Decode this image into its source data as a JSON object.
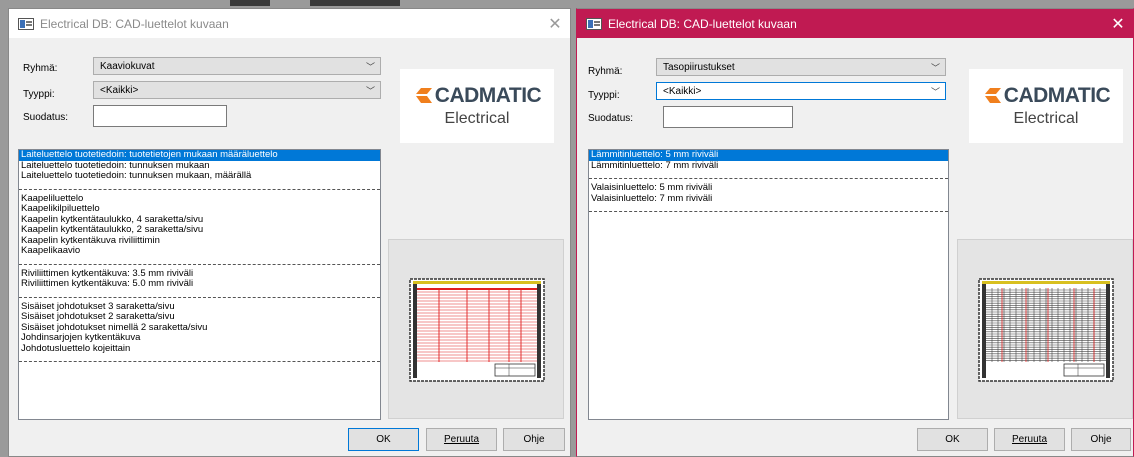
{
  "dialog1": {
    "title": "Electrical DB: CAD-luettelot kuvaan",
    "group_label": "Ryhmä:",
    "group_value": "Kaaviokuvat",
    "type_label": "Tyyppi:",
    "type_value": "<Kaikki>",
    "filter_label": "Suodatus:",
    "filter_value": "",
    "list": [
      {
        "text": "Laiteluettelo tuotetiedoin: tuotetietojen mukaan määräluettelo",
        "selected": true
      },
      {
        "text": "Laiteluettelo tuotetiedoin: tunnuksen mukaan"
      },
      {
        "text": "Laiteluettelo tuotetiedoin: tunnuksen mukaan, määrällä"
      },
      {
        "sep": true
      },
      {
        "text": "Kaapeliluettelo"
      },
      {
        "text": "Kaapelikilpiluettelo"
      },
      {
        "text": "Kaapelin kytkentätaulukko, 4 saraketta/sivu"
      },
      {
        "text": "Kaapelin kytkentätaulukko, 2 saraketta/sivu"
      },
      {
        "text": "Kaapelin kytkentäkuva riviliittimin"
      },
      {
        "text": "Kaapelikaavio"
      },
      {
        "sep": true
      },
      {
        "text": "Riviliittimen kytkentäkuva: 3.5 mm riviväli"
      },
      {
        "text": "Riviliittimen kytkentäkuva: 5.0 mm riviväli"
      },
      {
        "sep": true
      },
      {
        "text": "Sisäiset johdotukset 3 saraketta/sivu"
      },
      {
        "text": "Sisäiset johdotukset 2 saraketta/sivu"
      },
      {
        "text": "Sisäiset johdotukset nimellä 2 saraketta/sivu"
      },
      {
        "text": "Johdinsarjojen kytkentäkuva"
      },
      {
        "text": "Johdotusluettelo kojeittain"
      },
      {
        "sep": true
      }
    ],
    "ok_label": "OK",
    "cancel_label": "Peruuta",
    "help_label": "Ohje"
  },
  "dialog2": {
    "title": "Electrical DB: CAD-luettelot kuvaan",
    "group_label": "Ryhmä:",
    "group_value": "Tasopiirustukset",
    "type_label": "Tyyppi:",
    "type_value": "<Kaikki>",
    "filter_label": "Suodatus:",
    "filter_value": "",
    "list": [
      {
        "text": "Lämmitinluettelo: 5 mm riviväli",
        "selected": true
      },
      {
        "text": "Lämmitinluettelo: 7 mm riviväli"
      },
      {
        "sep": true
      },
      {
        "text": "Valaisinluettelo: 5 mm riviväli"
      },
      {
        "text": "Valaisinluettelo: 7 mm riviväli"
      },
      {
        "sep": true
      }
    ],
    "ok_label": "OK",
    "cancel_label": "Peruuta",
    "help_label": "Ohje"
  },
  "logo": {
    "brand": "CADMATIC",
    "product": "Electrical",
    "mark_color": "#f07f1d"
  },
  "colors": {
    "selection": "#0078d7",
    "active_title": "#c01a52",
    "preview_line_red": "#e02020"
  },
  "icons": {
    "close": "close-icon",
    "dropdown": "chevron-down-icon",
    "app": "app-icon"
  }
}
